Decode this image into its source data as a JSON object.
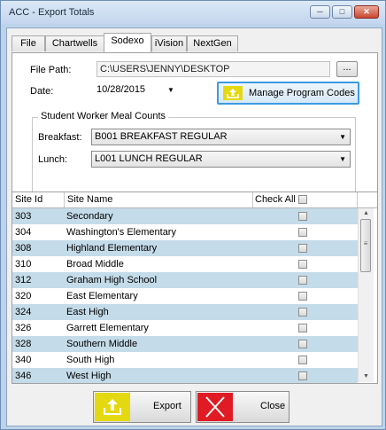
{
  "window": {
    "title": "ACC - Export Totals"
  },
  "tabs": [
    "File",
    "Chartwells",
    "Sodexo",
    "iVision",
    "NextGen"
  ],
  "form": {
    "file_path_label": "File Path:",
    "file_path_value": "C:\\USERS\\JENNY\\DESKTOP",
    "browse_label": "...",
    "date_label": "Date:",
    "date_value": "10/28/2015",
    "manage_program_codes_label": "Manage Program Codes",
    "group_title": "Student Worker Meal Counts",
    "breakfast_label": "Breakfast:",
    "breakfast_value": "B001  BREAKFAST REGULAR",
    "lunch_label": "Lunch:",
    "lunch_value": "L001  LUNCH REGULAR"
  },
  "grid": {
    "headers": {
      "site_id": "Site Id",
      "site_name": "Site Name",
      "check_all": "Check All"
    },
    "rows": [
      {
        "id": "303",
        "name": "Secondary"
      },
      {
        "id": "304",
        "name": "Washington's Elementary"
      },
      {
        "id": "308",
        "name": "Highland Elementary"
      },
      {
        "id": "310",
        "name": "Broad Middle"
      },
      {
        "id": "312",
        "name": "Graham High School"
      },
      {
        "id": "320",
        "name": "East Elementary"
      },
      {
        "id": "324",
        "name": "East High"
      },
      {
        "id": "326",
        "name": "Garrett Elementary"
      },
      {
        "id": "328",
        "name": "Southern Middle"
      },
      {
        "id": "340",
        "name": "South High"
      },
      {
        "id": "346",
        "name": "West High"
      }
    ]
  },
  "buttons": {
    "export_label": "Export",
    "close_label": "Close"
  },
  "colors": {
    "accent_yellow": "#e4d910",
    "close_red": "#e01b24",
    "row_alt": "#c4dbe9",
    "focus_blue": "#3c9ae1"
  },
  "icons": {
    "minimize": "minimize-icon",
    "maximize": "maximize-icon",
    "close": "close-icon",
    "upload": "upload-icon",
    "x": "x-icon"
  }
}
